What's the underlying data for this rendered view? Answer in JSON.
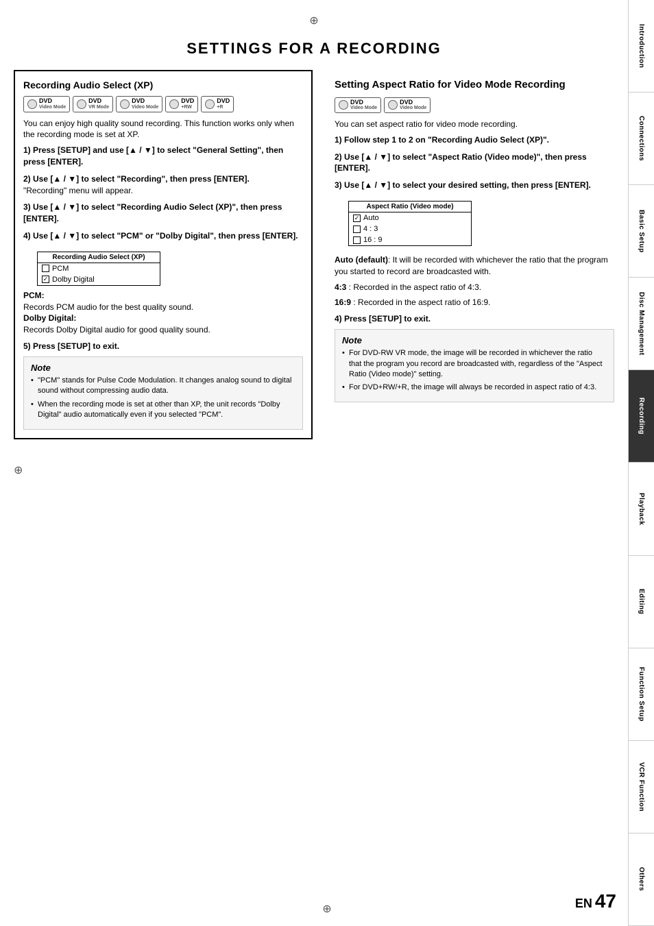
{
  "page": {
    "title": "SETTINGS FOR A RECORDING",
    "page_number": "47",
    "en_label": "EN"
  },
  "sidebar": {
    "items": [
      {
        "label": "Introduction",
        "active": false
      },
      {
        "label": "Connections",
        "active": false
      },
      {
        "label": "Basic Setup",
        "active": false
      },
      {
        "label": "Disc Management",
        "active": false
      },
      {
        "label": "Recording",
        "active": true
      },
      {
        "label": "Playback",
        "active": false
      },
      {
        "label": "Editing",
        "active": false
      },
      {
        "label": "Function Setup",
        "active": false
      },
      {
        "label": "VCR Function",
        "active": false
      },
      {
        "label": "Others",
        "active": false
      }
    ]
  },
  "left_section": {
    "title": "Recording Audio Select (XP)",
    "dvd_badges": [
      "DVD Video Mode",
      "DVD VR Mode",
      "DVD Video Mode",
      "DVD+RW",
      "DVD+R"
    ],
    "intro": "You can enjoy high quality sound recording. This function works only when the recording mode is set at XP.",
    "steps": [
      {
        "num": "1)",
        "text": "Press [SETUP] and use [▲ / ▼] to select \"General Setting\", then press [ENTER]."
      },
      {
        "num": "2)",
        "text": "Use [▲ / ▼] to select \"Recording\", then press [ENTER].",
        "sub": "\"Recording\" menu will appear."
      },
      {
        "num": "3)",
        "text": "Use [▲ / ▼] to select \"Recording Audio Select (XP)\", then press [ENTER]."
      },
      {
        "num": "4)",
        "text": "Use [▲ / ▼] to select \"PCM\" or \"Dolby Digital\", then press [ENTER]."
      }
    ],
    "menu_box": {
      "title": "Recording Audio Select (XP)",
      "items": [
        {
          "label": "PCM",
          "checked": false
        },
        {
          "label": "Dolby Digital",
          "checked": true
        }
      ]
    },
    "pcm_label": "PCM:",
    "pcm_desc": "Records PCM audio for the best quality sound.",
    "dolby_label": "Dolby Digital:",
    "dolby_desc": "Records Dolby Digital audio for good quality sound.",
    "step5": "5) Press [SETUP] to exit.",
    "note": {
      "title": "Note",
      "items": [
        "\"PCM\" stands for Pulse Code Modulation. It changes analog sound to digital sound without compressing audio data.",
        "When the recording mode is set at other than XP, the unit records \"Dolby Digital\" audio automatically even if you selected \"PCM\"."
      ]
    }
  },
  "right_section": {
    "title": "Setting Aspect Ratio for Video Mode Recording",
    "dvd_badges": [
      "DVD Video Mode",
      "DVD Video Mode"
    ],
    "intro": "You can set aspect ratio for video mode recording.",
    "steps": [
      {
        "num": "1)",
        "text": "Follow step 1 to 2 on \"Recording Audio Select (XP)\"."
      },
      {
        "num": "2)",
        "text": "Use [▲ / ▼] to select \"Aspect Ratio (Video mode)\", then press [ENTER]."
      },
      {
        "num": "3)",
        "text": "Use [▲ / ▼] to select your desired setting, then press [ENTER]."
      }
    ],
    "menu_box": {
      "title": "Aspect Ratio (Video mode)",
      "items": [
        {
          "label": "Auto",
          "checked": true
        },
        {
          "label": "4 : 3",
          "checked": false
        },
        {
          "label": "16 : 9",
          "checked": false
        }
      ]
    },
    "auto_desc": "Auto (default): It will be recorded with whichever the ratio that the program you started to record are broadcasted with.",
    "ratio_43": "4:3 :    Recorded in the aspect ratio of 4:3.",
    "ratio_169": "16:9 :  Recorded in the aspect ratio of 16:9.",
    "step4": "4) Press [SETUP] to exit.",
    "note": {
      "title": "Note",
      "items": [
        "For DVD-RW VR mode, the image will be recorded in whichever the ratio that the program you record are broadcasted with, regardless of the \"Aspect Ratio (Video mode)\" setting.",
        "For DVD+RW/+R, the image will always be recorded in aspect ratio of 4:3."
      ]
    }
  }
}
